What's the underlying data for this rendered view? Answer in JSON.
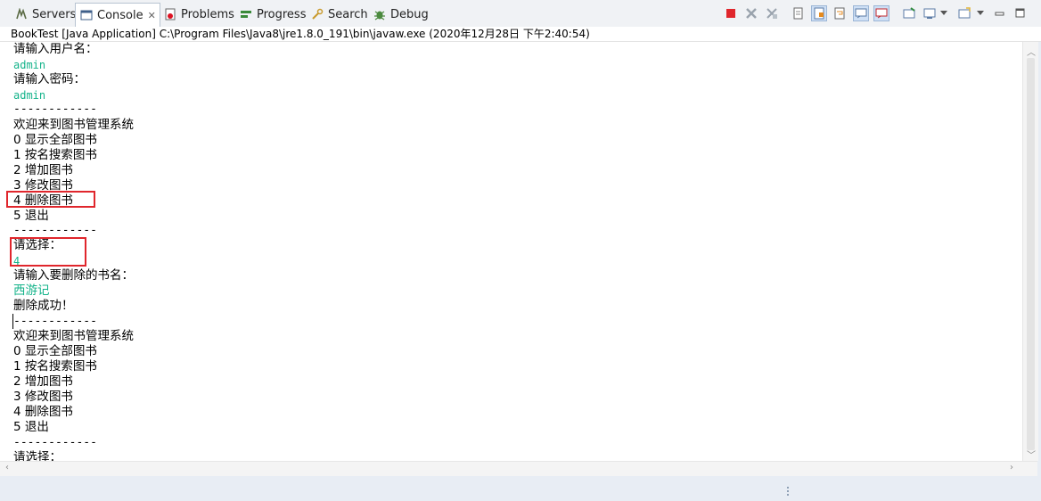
{
  "tabs": [
    {
      "label": "Servers",
      "icon": "servers-icon"
    },
    {
      "label": "Console",
      "icon": "console-icon",
      "active": true
    },
    {
      "label": "Problems",
      "icon": "problems-icon"
    },
    {
      "label": "Progress",
      "icon": "progress-icon"
    },
    {
      "label": "Search",
      "icon": "search-icon"
    },
    {
      "label": "Debug",
      "icon": "debug-icon"
    }
  ],
  "toolbar": [
    "terminate-icon",
    "remove-launch-icon",
    "remove-all-terminated-icon",
    "clear-console-icon",
    "scroll-lock-icon",
    "word-wrap-icon",
    "show-on-stdout-icon",
    "show-on-stderr-icon",
    "pin-console-icon",
    "display-selected-console-icon",
    "open-console-icon",
    "view-menu-icon",
    "minimize-icon",
    "maximize-icon"
  ],
  "console": {
    "launch_info": "BookTest [Java Application] C:\\Program Files\\Java8\\jre1.8.0_191\\bin\\javaw.exe (2020年12月28日 下午2:40:54)",
    "lines": [
      "请输入用户名：",
      "admin",
      "请输入密码：",
      "admin",
      "------------",
      "欢迎来到图书管理系统",
      "0 显示全部图书",
      "1 按名搜索图书",
      "2 增加图书",
      "3 修改图书",
      "4 删除图书",
      "5 退出",
      "------------",
      "请选择：",
      "4",
      "请输入要删除的书名：",
      "西游记",
      "删除成功！",
      "------------",
      "欢迎来到图书管理系统",
      "0 显示全部图书",
      "1 按名搜索图书",
      "2 增加图书",
      "3 修改图书",
      "4 删除图书",
      "5 退出",
      "------------",
      "请选择："
    ]
  },
  "colors": {
    "user_input": "#14b38a",
    "highlight_box": "#e0262c"
  }
}
